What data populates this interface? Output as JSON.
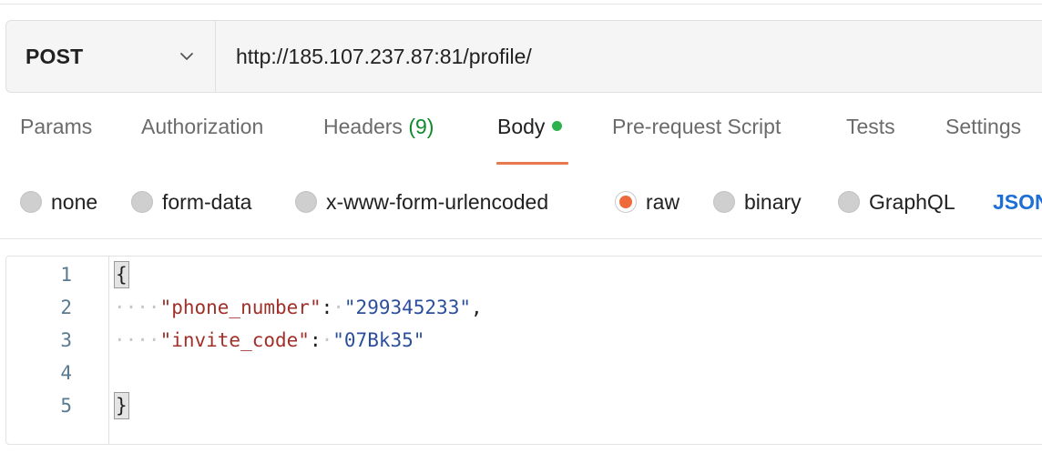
{
  "request": {
    "method": "POST",
    "url": "http://185.107.237.87:81/profile/"
  },
  "tabs": [
    {
      "label": "Params"
    },
    {
      "label": "Authorization"
    },
    {
      "label": "Headers",
      "count": "(9)"
    },
    {
      "label": "Body",
      "active": true
    },
    {
      "label": "Pre-request Script"
    },
    {
      "label": "Tests"
    },
    {
      "label": "Settings"
    }
  ],
  "body_types": {
    "options": [
      "none",
      "form-data",
      "x-www-form-urlencoded",
      "raw",
      "binary",
      "GraphQL"
    ],
    "selected": "raw",
    "format": "JSON"
  },
  "editor": {
    "line_numbers": [
      "1",
      "2",
      "3",
      "4",
      "5"
    ],
    "open_brace": "{",
    "close_brace": "}",
    "indent": "····",
    "entries": [
      {
        "key": "\"phone_number\"",
        "colon": ":",
        "space": "·",
        "value": "\"299345233\"",
        "trail": ","
      },
      {
        "key": "\"invite_code\"",
        "colon": ":",
        "space": "·",
        "value": "\"07Bk35\"",
        "trail": ""
      }
    ]
  },
  "colors": {
    "accent": "#e8794e",
    "body_dot": "#2bb24c",
    "headers_count": "#0f8a2d",
    "json_link": "#1d6fd6",
    "json_key": "#a2302a",
    "json_string": "#2c4f9c"
  },
  "icons": {
    "method_dropdown": "chevron-down-icon"
  }
}
